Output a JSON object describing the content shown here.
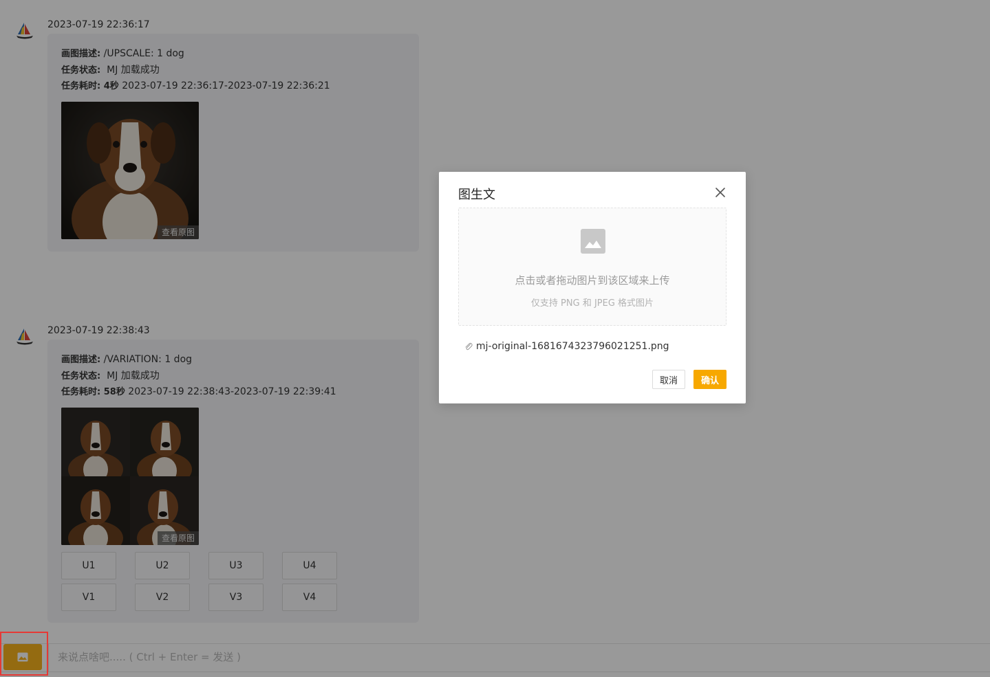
{
  "messages": [
    {
      "timestamp": "2023-07-19 22:36:17",
      "desc_label": "画图描述:",
      "desc_value": "/UPSCALE: 1 dog",
      "status_label": "任务状态:",
      "status_value": "MJ 加载成功",
      "duration_label": "任务耗时: 4秒",
      "duration_value": "2023-07-19 22:36:17-2023-07-19 22:36:21",
      "view_original": "查看原图"
    },
    {
      "timestamp": "2023-07-19 22:38:43",
      "desc_label": "画图描述:",
      "desc_value": "/VARIATION: 1 dog",
      "status_label": "任务状态:",
      "status_value": "MJ 加载成功",
      "duration_label": "任务耗时: 58秒",
      "duration_value": "2023-07-19 22:38:43-2023-07-19 22:39:41",
      "view_original": "查看原图",
      "buttons": [
        "U1",
        "U2",
        "U3",
        "U4",
        "V1",
        "V2",
        "V3",
        "V4"
      ]
    }
  ],
  "input": {
    "placeholder": "来说点啥吧..... ( Ctrl + Enter = 发送 )",
    "value": ""
  },
  "modal": {
    "title": "图生文",
    "upload_hint": "点击或者拖动图片到该区域来上传",
    "upload_subhint": "仅支持 PNG 和 JPEG 格式图片",
    "file_name": "mj-original-1681674323796021251.png",
    "cancel_label": "取消",
    "confirm_label": "确认"
  },
  "colors": {
    "accent": "#f7a800",
    "image_button": "#f7b21d",
    "highlight_frame": "#e53935",
    "overlay": "rgba(0,0,0,0.4)"
  },
  "icons": {
    "avatar": "sailboat-logo-icon",
    "image_button": "image-icon",
    "upload": "image-placeholder-icon",
    "close": "close-icon",
    "attachment": "paperclip-icon"
  }
}
